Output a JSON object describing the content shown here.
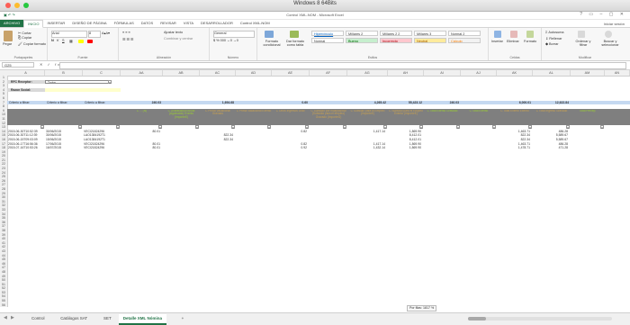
{
  "window": {
    "mac_title": "Windows 8 64Bits",
    "excel_title": "Control XML-NOM - Microsoft Excel"
  },
  "ribbon_tabs": [
    "ARCHIVO",
    "INICIO",
    "INSERTAR",
    "DISEÑO DE PÁGINA",
    "FÓRMULAS",
    "DATOS",
    "REVISAR",
    "VISTA",
    "DESARROLLADOR",
    "Control XML-NOM"
  ],
  "signin": "Iniciar sesión",
  "ribbon": {
    "clipboard": {
      "paste": "Pegar",
      "cut": "Cortar",
      "copy": "Copiar",
      "format_painter": "Copiar formato",
      "label": "Portapapeles"
    },
    "font": {
      "name": "Arial",
      "size": "8",
      "label": "Fuente"
    },
    "alignment": {
      "wrap": "Ajustar texto",
      "merge": "Combinar y centrar",
      "label": "Alineación"
    },
    "number": {
      "format": "General",
      "label": "Número"
    },
    "styles": {
      "conditional": "Formato condicional",
      "as_table": "Dar formato como tabla",
      "cells": [
        {
          "text": "Hipervínculo",
          "bg": "#ffffff",
          "fg": "#0563c1"
        },
        {
          "text": "Millares 2",
          "bg": "#ffffff",
          "fg": "#333333"
        },
        {
          "text": "Millares 2 2",
          "bg": "#ffffff",
          "fg": "#333333"
        },
        {
          "text": "Millares 3",
          "bg": "#ffffff",
          "fg": "#333333"
        },
        {
          "text": "Normal 2",
          "bg": "#ffffff",
          "fg": "#333333"
        },
        {
          "text": "Normal",
          "bg": "#ffffff",
          "fg": "#333333"
        },
        {
          "text": "Bueno",
          "bg": "#c6efce",
          "fg": "#006100"
        },
        {
          "text": "Incorrecto",
          "bg": "#ffc7ce",
          "fg": "#9c0006"
        },
        {
          "text": "Neutral",
          "bg": "#ffeb9c",
          "fg": "#9c5700"
        },
        {
          "text": "Cálculo",
          "bg": "#f2f2f2",
          "fg": "#fa7d00"
        }
      ],
      "label": "Estilos"
    },
    "cells": {
      "insert": "Insertar",
      "delete": "Eliminar",
      "format": "Formato",
      "label": "Celdas"
    },
    "editing": {
      "autosum": "Autosuma",
      "fill": "Rellenar",
      "clear": "Borrar",
      "sort": "Ordenar y filtrar",
      "find": "Buscar y seleccionar",
      "label": "Modificar"
    }
  },
  "formula_bar": {
    "name_box": "G25",
    "fx": "fx"
  },
  "columns": [
    "A",
    "B",
    "C",
    "AA",
    "AB",
    "AC",
    "AD",
    "AE",
    "AF",
    "AG",
    "AH",
    "AI",
    "AJ",
    "AK",
    "AL",
    "AM",
    "AN"
  ],
  "rows": {
    "numbers": [
      "1",
      "2",
      "3",
      "4",
      "5",
      "6",
      "7",
      "8",
      "9",
      "10",
      "11",
      "12",
      "13",
      "14",
      "15",
      "16",
      "17",
      "18",
      "19",
      "20",
      "21",
      "22",
      "23",
      "24",
      "25",
      "26",
      "27",
      "28",
      "29",
      "30",
      "31",
      "32",
      "33",
      "34",
      "35",
      "36",
      "37",
      "38",
      "39",
      "40",
      "41",
      "42",
      "43",
      "44",
      "45",
      "46",
      "47",
      "48",
      "49",
      "50",
      "51",
      "52",
      "53",
      "54",
      "55",
      "56"
    ],
    "rfc_label": "RFC Receptor:",
    "rfc_value": "Todos",
    "razon_label": "Razon Social:",
    "criteria": [
      "Criterio a filtrar:",
      "Criterio a filtrar:",
      "Criterio a filtrar:"
    ],
    "totals": [
      "240.03",
      "",
      "1,694.68",
      "",
      "0.60",
      "",
      "4,265.42",
      "55,423.12",
      "240.03",
      "",
      "6,000.01",
      "12,622.84"
    ],
    "header_cols": [
      "FECHA_TIMBR",
      "FECHA_PAG",
      "RFC_EMISOR"
    ],
    "band_headers": [
      {
        "t": "C ... (N)",
        "g": true
      },
      {
        "t": "C Gratificación Anual (Aguinaldo) Exento (ImporteE)",
        "g": true
      },
      {
        "t": "C Prima Vacacional Gravado",
        "g": false
      },
      {
        "t": "C Prima Vacacional Exento",
        "g": false
      },
      {
        "t": "C Otros Ingresos Grav.",
        "g": false
      },
      {
        "t": "C Subsidio por Incapacidad (Subsidio para el empleo) Gravado (ImporteG)",
        "g": false
      },
      {
        "t": "C Subsidio para el Empleo (ImporteE)",
        "g": false
      },
      {
        "t": "C Subsidio para el Empleo Exento (ImporteE)",
        "g": false
      },
      {
        "t": "C Total Exento Gravado",
        "g": true
      },
      {
        "t": "C Total Exento",
        "g": true
      },
      {
        "t": "C Total Exento Exento",
        "g": false
      },
      {
        "t": "C Total Ingreso Gravado",
        "g": false
      },
      {
        "t": "Total Percep.",
        "g": true
      }
    ],
    "data": [
      [
        "2015-06-30T10:52:39",
        "30/06/2015",
        "VECI21824296",
        "80.01",
        "",
        "",
        "",
        "0.82",
        "",
        "1,417.14",
        "1,869.90",
        "",
        "",
        "1,463.71",
        "486.28"
      ],
      [
        "2015-06-30T11:12:39",
        "30/06/2015",
        "LAO1384192T1",
        "",
        "",
        "822.34",
        "",
        "",
        "",
        "",
        "8,412.01",
        "",
        "",
        "822.34",
        "5,589.67"
      ],
      [
        "2015-06-15T09:03:09",
        "15/06/2015",
        "LAO1384192T1",
        "",
        "",
        "822.34",
        "",
        "",
        "",
        "",
        "8,412.01",
        "",
        "",
        "822.34",
        "5,589.67"
      ],
      [
        "2015-06-17T16:56:36",
        "17/06/2015",
        "VECI21824296",
        "80.01",
        "",
        "",
        "",
        "0.82",
        "",
        "1,417.14",
        "1,869.90",
        "",
        "",
        "1,463.71",
        "486.28"
      ],
      [
        "2015-07-16T10:53:26",
        "16/07/2015",
        "VECI21824296",
        "80.01",
        "",
        "",
        "",
        "0.92",
        "",
        "1,432.14",
        "1,869.90",
        "",
        "",
        "1,478.71",
        "471.28"
      ]
    ]
  },
  "sheets": [
    "Control",
    "Catálogos SAT",
    "SET",
    "Detalle XML Nómina"
  ],
  "active_sheet": "Detalle XML Nómina",
  "status_tip": "Por filas: 1817 %",
  "add_sheet": "+"
}
